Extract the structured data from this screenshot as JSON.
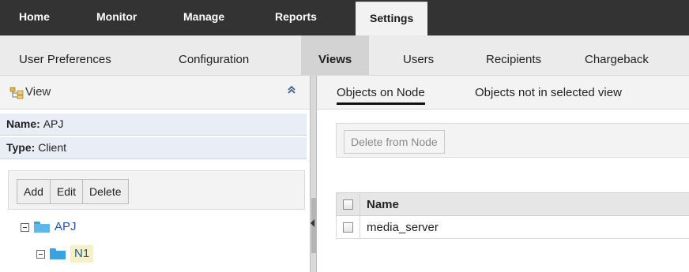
{
  "topnav": {
    "tabs": [
      "Home",
      "Monitor",
      "Manage",
      "Reports",
      "Settings"
    ],
    "active": "Settings"
  },
  "subnav": {
    "items": [
      "User Preferences",
      "Configuration",
      "Views",
      "Users",
      "Recipients",
      "Chargeback"
    ],
    "active": "Views"
  },
  "left": {
    "header_title": "View",
    "name_label": "Name:",
    "name_value": "APJ",
    "type_label": "Type:",
    "type_value": "Client",
    "buttons": {
      "add": "Add",
      "edit": "Edit",
      "delete": "Delete"
    },
    "tree": [
      {
        "label": "APJ",
        "level": 0,
        "expanded": true
      },
      {
        "label": "N1",
        "level": 1,
        "expanded": true,
        "selected": true
      }
    ]
  },
  "right": {
    "tabs": [
      "Objects on Node",
      "Objects not in selected view"
    ],
    "active_tab": "Objects on Node",
    "delete_button": "Delete from Node",
    "table": {
      "header": "Name",
      "rows": [
        "media_server"
      ]
    }
  },
  "colors": {
    "topnav_bg": "#333333",
    "subnav_bg": "#ebebeb",
    "link": "#2255aa",
    "folder": "#39a3e0",
    "selected_highlight": "#f7efc6"
  }
}
